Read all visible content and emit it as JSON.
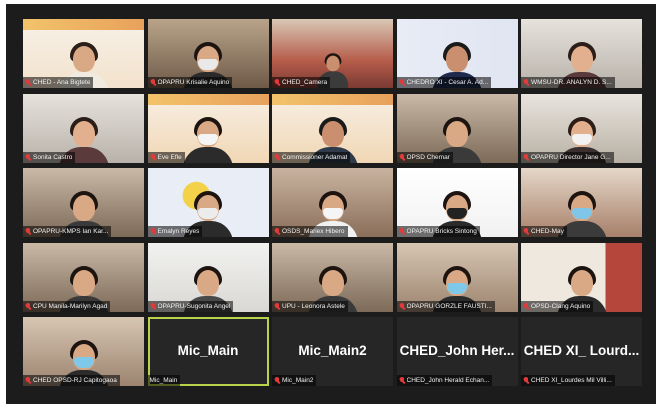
{
  "window": {
    "title": ""
  },
  "participants": [
    {
      "name": "CHED - Ana Bigtete",
      "scene": "slide"
    },
    {
      "name": "OPAPRU Krisalie Aquino",
      "scene": "room-mask"
    },
    {
      "name": "CHED_Camera",
      "scene": "hall"
    },
    {
      "name": "CHEDRO XI - Cesar A. Ad...",
      "scene": "poster"
    },
    {
      "name": "WMSU-DR. ANALYN D. S...",
      "scene": "office"
    },
    {
      "name": "Sonita Castro",
      "scene": "office"
    },
    {
      "name": "Eve Efle",
      "scene": "slide-mask"
    },
    {
      "name": "Commissioner Adamat",
      "scene": "slide-person"
    },
    {
      "name": "OPSD Chemar",
      "scene": "room"
    },
    {
      "name": "OPAPRU Director Jane G...",
      "scene": "office-mask"
    },
    {
      "name": "OPAPRU-KMPS Ian Kar...",
      "scene": "room"
    },
    {
      "name": "Emalyn Reyes",
      "scene": "seal-mask"
    },
    {
      "name": "OSDS_Mariex Hibero",
      "scene": "group-mask"
    },
    {
      "name": "OPAPRU Bricks Sintong",
      "scene": "seal-white"
    },
    {
      "name": "CHED-May",
      "scene": "group-mask2"
    },
    {
      "name": "CPU Manila-Marilyn Agad",
      "scene": "room"
    },
    {
      "name": "OPAPRU-Sugonita Angel",
      "scene": "white-room"
    },
    {
      "name": "UPU - Leonora Astele",
      "scene": "room"
    },
    {
      "name": "OPAPRU GORZLE FAUSTI...",
      "scene": "mask-room"
    },
    {
      "name": "OPSD-Clang Aquino",
      "scene": "building"
    },
    {
      "name": "CHED OPSD-RJ Capitogaoa",
      "scene": "mask-room"
    },
    {
      "name": "Mic_Main",
      "scene": "blank",
      "display": "Mic_Main",
      "active": true
    },
    {
      "name": "Mic_Main2",
      "scene": "blank",
      "display": "Mic_Main2"
    },
    {
      "name": "CHED_John Herald Echan...",
      "scene": "blank",
      "display": "CHED_John Her..."
    },
    {
      "name": "CHED XI_Lourdes Mil Villi...",
      "scene": "blank",
      "display": "CHED XI_ Lourd..."
    }
  ]
}
